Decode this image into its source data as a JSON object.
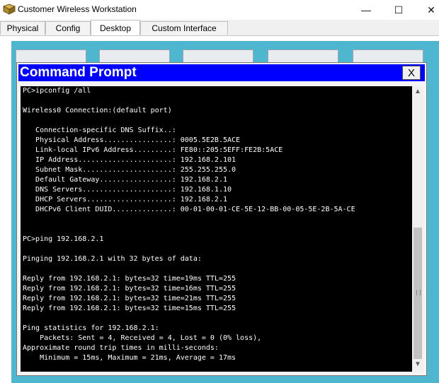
{
  "window": {
    "title": "Customer Wireless Workstation",
    "controls": {
      "minimize": "—",
      "maximize": "☐",
      "close": "✕"
    }
  },
  "tabs": [
    {
      "label": "Physical",
      "active": false
    },
    {
      "label": "Config",
      "active": false
    },
    {
      "label": "Desktop",
      "active": true
    },
    {
      "label": "Custom Interface",
      "active": false
    }
  ],
  "desktop": {
    "background_color": "#4eb6cf"
  },
  "command_prompt": {
    "title": "Command Prompt",
    "close_label": "X",
    "title_color": "#0000ff",
    "lines": [
      "PC>ipconfig /all",
      "",
      "Wireless0 Connection:(default port)",
      "",
      "   Connection-specific DNS Suffix..:",
      "   Physical Address................: 0005.5E2B.5ACE",
      "   Link-local IPv6 Address.........: FE80::205:5EFF:FE2B:5ACE",
      "   IP Address......................: 192.168.2.101",
      "   Subnet Mask.....................: 255.255.255.0",
      "   Default Gateway.................: 192.168.2.1",
      "   DNS Servers.....................: 192.168.1.10",
      "   DHCP Servers....................: 192.168.2.1",
      "   DHCPv6 Client DUID..............: 00-01-00-01-CE-5E-12-BB-00-05-5E-2B-5A-CE",
      "",
      "",
      "PC>ping 192.168.2.1",
      "",
      "Pinging 192.168.2.1 with 32 bytes of data:",
      "",
      "Reply from 192.168.2.1: bytes=32 time=19ms TTL=255",
      "Reply from 192.168.2.1: bytes=32 time=16ms TTL=255",
      "Reply from 192.168.2.1: bytes=32 time=21ms TTL=255",
      "Reply from 192.168.2.1: bytes=32 time=15ms TTL=255",
      "",
      "Ping statistics for 192.168.2.1:",
      "    Packets: Sent = 4, Received = 4, Lost = 0 (0% loss),",
      "Approximate round trip times in milli-seconds:",
      "    Minimum = 15ms, Maximum = 21ms, Average = 17ms"
    ]
  }
}
